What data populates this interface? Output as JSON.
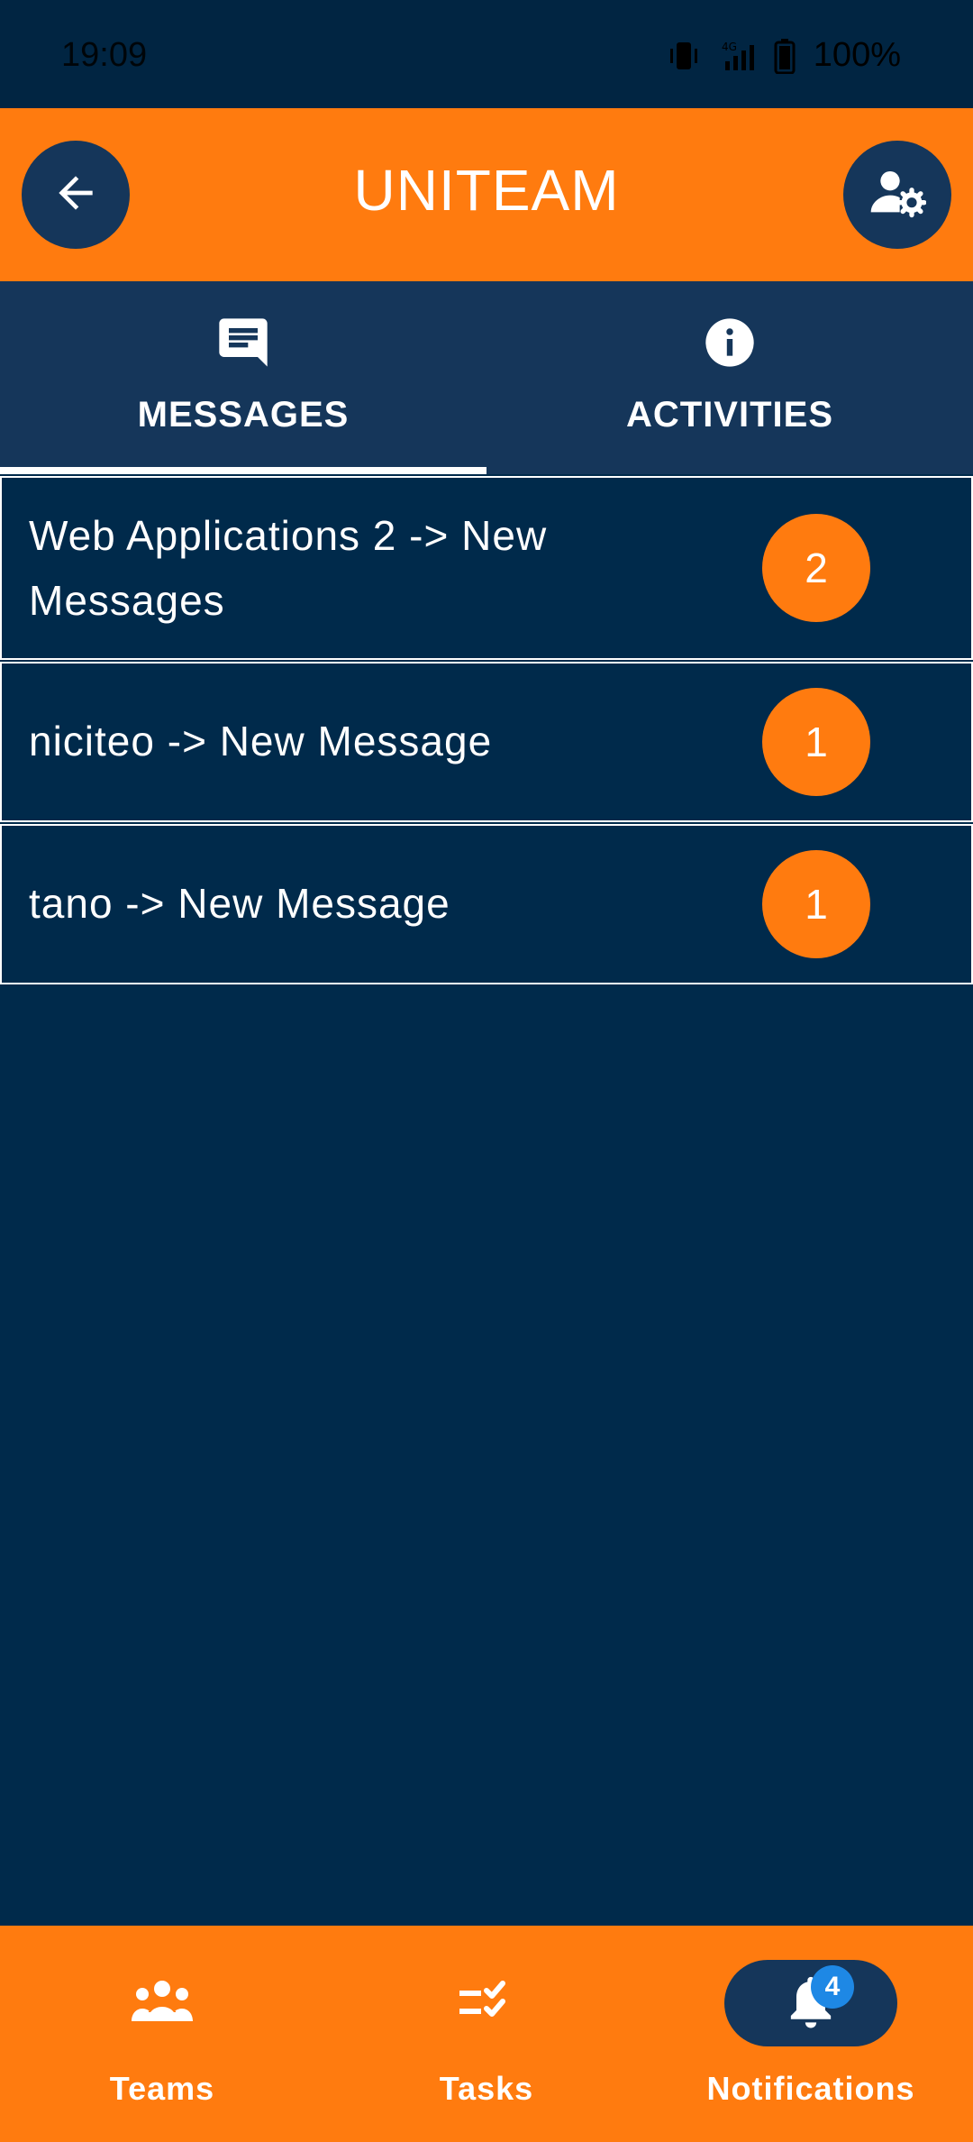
{
  "status_bar": {
    "time": "19:09",
    "battery_percent": "100%",
    "network": "4G",
    "icons": [
      "vibrate-icon",
      "signal-icon",
      "battery-icon"
    ]
  },
  "app_bar": {
    "title": "UNITEAM",
    "back_icon": "arrow-left-icon",
    "settings_icon": "user-settings-icon",
    "background_color": "#ff7b0f"
  },
  "tabs": [
    {
      "label": "MESSAGES",
      "icon": "message-icon",
      "selected": true
    },
    {
      "label": "ACTIVITIES",
      "icon": "info-icon",
      "selected": false
    }
  ],
  "notifications": [
    {
      "text": "Web Applications 2 -> New Messages",
      "count": "2"
    },
    {
      "text": "niciteo -> New Message",
      "count": "1"
    },
    {
      "text": "tano -> New Message",
      "count": "1"
    }
  ],
  "bottom_nav": {
    "items": [
      {
        "label": "Teams",
        "icon": "teams-icon",
        "selected": false
      },
      {
        "label": "Tasks",
        "icon": "tasks-icon",
        "selected": false
      },
      {
        "label": "Notifications",
        "icon": "bell-icon",
        "selected": true,
        "badge": "4"
      }
    ]
  },
  "colors": {
    "accent": "#ff7b0f",
    "background": "#002a4b",
    "surface": "#15365a",
    "badge_blue": "#1e88e5"
  }
}
